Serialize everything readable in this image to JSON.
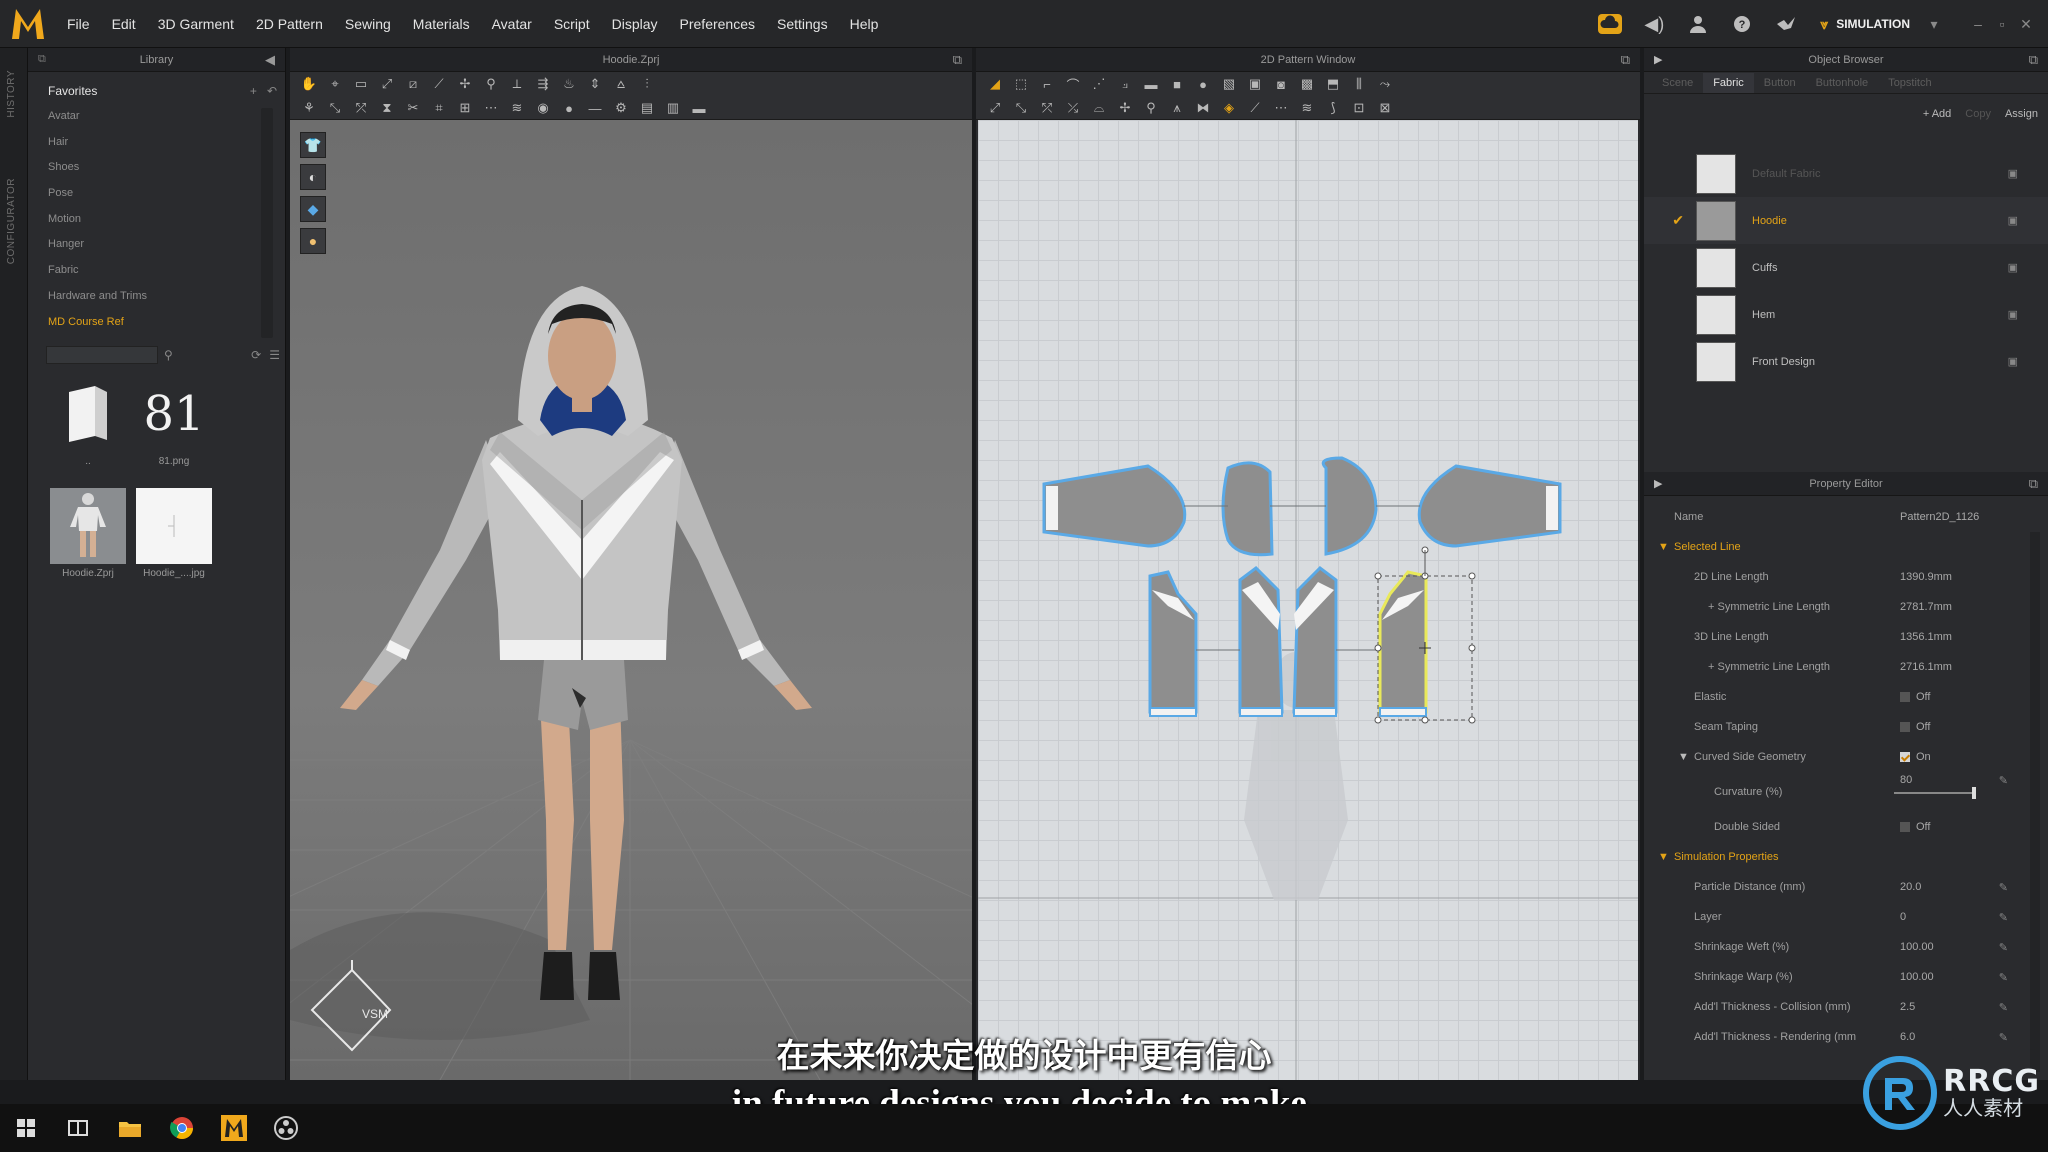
{
  "menubar": {
    "items": [
      "File",
      "Edit",
      "3D Garment",
      "2D Pattern",
      "Sewing",
      "Materials",
      "Avatar",
      "Script",
      "Display",
      "Preferences",
      "Settings",
      "Help"
    ],
    "simulation_label": "SIMULATION"
  },
  "library": {
    "title": "Library",
    "favorites_label": "Favorites",
    "items": [
      "Avatar",
      "Hair",
      "Shoes",
      "Pose",
      "Motion",
      "Hanger",
      "Fabric",
      "Hardware and Trims",
      "MD Course Ref"
    ],
    "files": [
      {
        "name": ".."
      },
      {
        "name": "81.png",
        "glyph": "81"
      },
      {
        "name": "Hoodie.Zprj"
      },
      {
        "name": "Hoodie_....jpg"
      }
    ]
  },
  "viewport3d": {
    "title": "Hoodie.Zprj",
    "gizmo_label": "VSM"
  },
  "pattern2d": {
    "title": "2D Pattern Window"
  },
  "object_browser": {
    "title": "Object Browser",
    "tabs": [
      "Scene",
      "Fabric",
      "Button",
      "Buttonhole",
      "Topstitch"
    ],
    "active_tab": "Fabric",
    "actions": {
      "add": "+ Add",
      "copy": "Copy",
      "assign": "Assign"
    },
    "fabrics": [
      {
        "name": "Default Fabric"
      },
      {
        "name": "Hoodie"
      },
      {
        "name": "Cuffs"
      },
      {
        "name": "Hem"
      },
      {
        "name": "Front Design"
      }
    ]
  },
  "property_editor": {
    "title": "Property Editor",
    "name_label": "Name",
    "name_value": "Pattern2D_1126",
    "selected_line_label": "Selected Line",
    "rows": [
      {
        "label": "2D Line Length",
        "value": "1390.9mm"
      },
      {
        "label": "+ Symmetric Line Length",
        "value": "2781.7mm"
      },
      {
        "label": "3D Line Length",
        "value": "1356.1mm"
      },
      {
        "label": "+ Symmetric Line Length",
        "value": "2716.1mm"
      }
    ],
    "elastic_label": "Elastic",
    "elastic_value": "Off",
    "seam_taping_label": "Seam Taping",
    "seam_taping_value": "Off",
    "curved_label": "Curved Side Geometry",
    "curved_value": "On",
    "curvature_label": "Curvature (%)",
    "curvature_value": "80",
    "double_sided_label": "Double Sided",
    "double_sided_value": "Off",
    "sim_label": "Simulation Properties",
    "sim_rows": [
      {
        "label": "Particle Distance (mm)",
        "value": "20.0"
      },
      {
        "label": "Layer",
        "value": "0"
      },
      {
        "label": "Shrinkage Weft (%)",
        "value": "100.00"
      },
      {
        "label": "Shrinkage Warp (%)",
        "value": "100.00"
      },
      {
        "label": "Add'l Thickness - Collision (mm)",
        "value": "2.5"
      },
      {
        "label": "Add'l Thickness - Rendering (mm",
        "value": "6.0"
      }
    ]
  },
  "subtitles": {
    "chinese": "在未来你决定做的设计中更有信心",
    "english": "in future designs you decide to make."
  },
  "watermark": {
    "brand": "RRCG",
    "chinese": "人人素材"
  },
  "colors": {
    "accent": "#e3a317",
    "pattern_outline": "#5aa9e6",
    "selected_piece": "#e9e95a"
  }
}
